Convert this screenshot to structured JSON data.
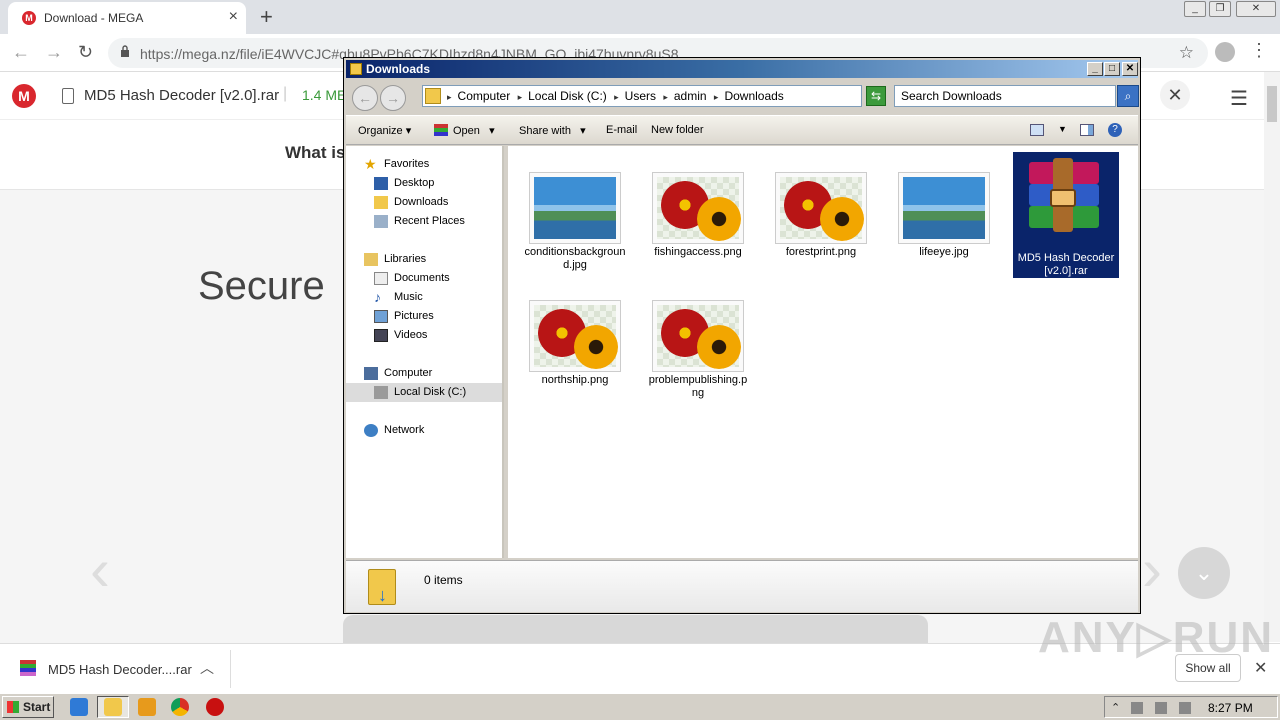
{
  "browser": {
    "tab_title": "Download - MEGA",
    "tab_favicon_letter": "M",
    "new_tab": "+",
    "url": "https://mega.nz/file/iE4WVCJC#qbu8PvPb6C7KDIhzd8n4JNBM_GO_ibi47buvnrv8uS8",
    "star_glyph": "☆",
    "window_controls": [
      "_",
      "❐",
      "✕"
    ]
  },
  "mega": {
    "logo_letter": "M",
    "file_name": "MD5 Hash Decoder [v2.0].rar",
    "separator": "|",
    "file_size": "1.4 ME",
    "what_is": "What is",
    "hero_text": "Secure",
    "close_glyph": "✕",
    "menu_glyph": "☰",
    "arrow_left": "‹",
    "arrow_right": "›",
    "down_glyph": "⌄"
  },
  "download_shelf": {
    "item_name": "MD5 Hash Decoder....rar",
    "show_all": "Show all",
    "close_glyph": "✕"
  },
  "watermark": "ANY▷RUN",
  "taskbar": {
    "start_label": "Start",
    "clock": "8:27 PM"
  },
  "explorer": {
    "title": "Downloads",
    "window_buttons": [
      "_",
      "□",
      "✕"
    ],
    "breadcrumbs": [
      "Computer",
      "Local Disk (C:)",
      "Users",
      "admin",
      "Downloads"
    ],
    "search_placeholder": "Search Downloads",
    "commands": {
      "organize": "Organize",
      "open": "Open",
      "share_with": "Share with",
      "email": "E-mail",
      "new_folder": "New folder"
    },
    "nav": {
      "favorites": "Favorites",
      "desktop": "Desktop",
      "downloads": "Downloads",
      "recent_places": "Recent Places",
      "libraries": "Libraries",
      "documents": "Documents",
      "music": "Music",
      "pictures": "Pictures",
      "videos": "Videos",
      "computer": "Computer",
      "local_disk": "Local Disk (C:)",
      "network": "Network"
    },
    "files": [
      {
        "name": "conditionsbackground.jpg",
        "kind": "landscape"
      },
      {
        "name": "fishingaccess.png",
        "kind": "flower"
      },
      {
        "name": "forestprint.png",
        "kind": "flower"
      },
      {
        "name": "lifeeye.jpg",
        "kind": "landscape"
      },
      {
        "name": "MD5 Hash Decoder [v2.0].rar",
        "kind": "winrar",
        "selected": true
      },
      {
        "name": "northship.png",
        "kind": "flower"
      },
      {
        "name": "problempublishing.png",
        "kind": "flower"
      }
    ],
    "status": "0 items"
  }
}
